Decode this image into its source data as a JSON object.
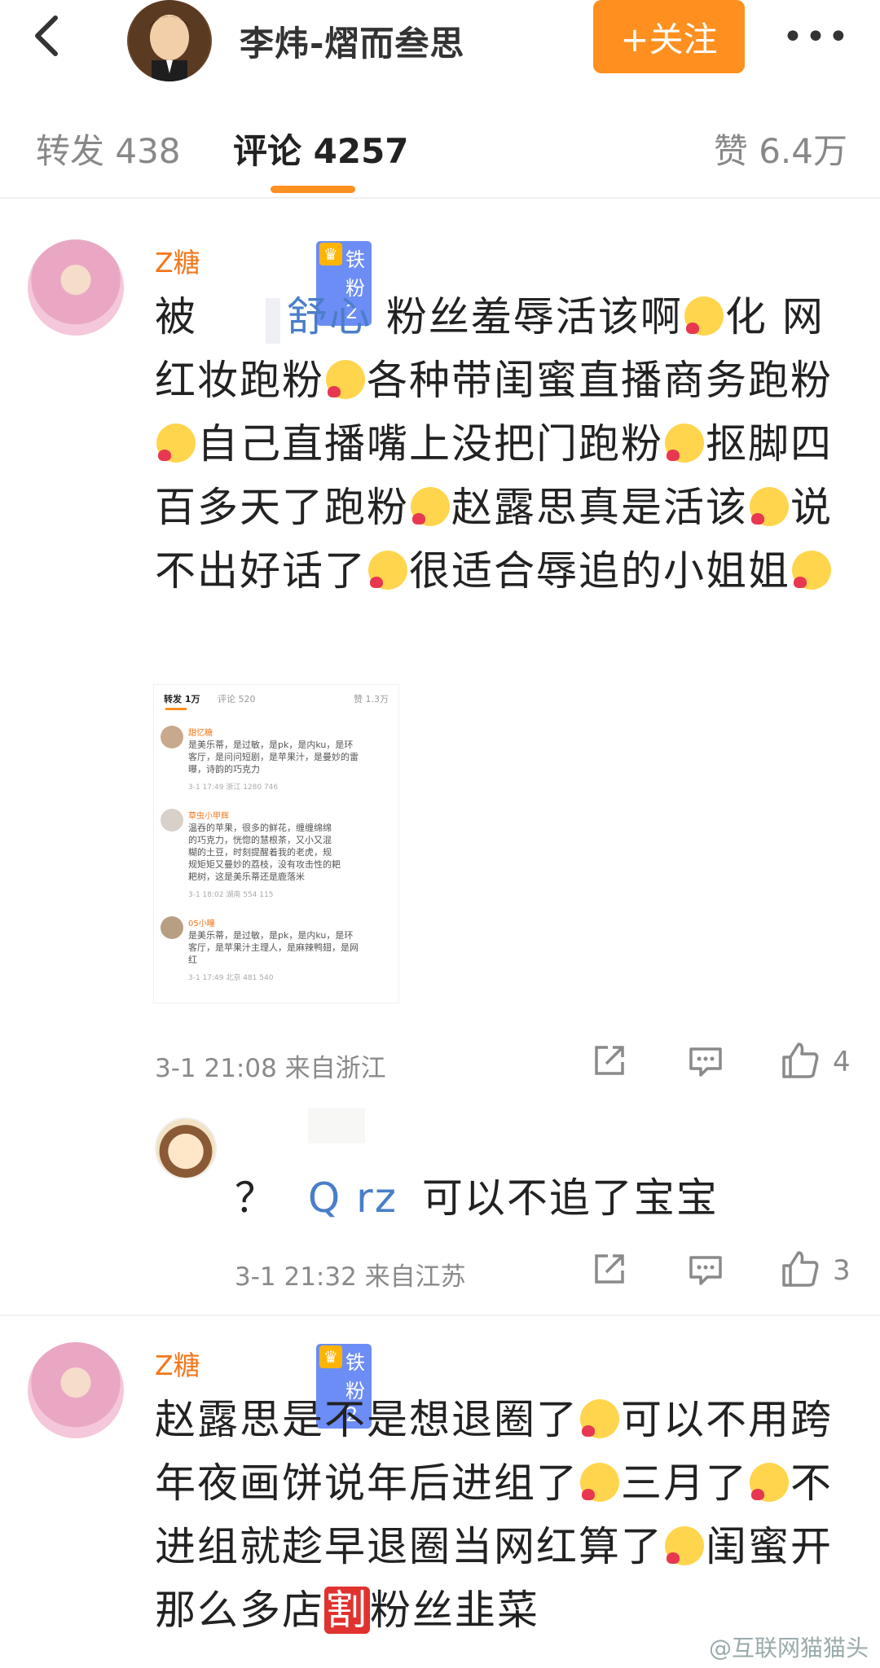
{
  "header": {
    "author_name": "李炜-熠而叁思",
    "follow_label": "+关注",
    "more_label": "•••"
  },
  "tabs": {
    "repost": "转发 438",
    "comment": "评论 4257",
    "like": "赞 6.4万"
  },
  "comments": [
    {
      "username": "Z糖",
      "badge": "铁粉2",
      "text_parts": [
        "被",
        "舒心",
        "粉丝羞辱活该啊",
        "化网红妆跑粉",
        "各种带闺蜜直播商务跑粉",
        "自己直播嘴上没把门跑粉",
        "抠脚四百多天了跑粉",
        "赵露思真是活该",
        "说不出好话了",
        "很适合辱追的小姐姐"
      ],
      "time_location": "3-1 21:08 来自浙江",
      "like_count": "4"
    },
    {
      "username": "",
      "text_prefix": "？",
      "text_mention": "Q rz",
      "text_main": "可以不追了宝宝",
      "time_location": "3-1 21:32 来自江苏",
      "like_count": "3"
    },
    {
      "username": "Z糖",
      "badge": "铁粉2",
      "text_parts": [
        "赵露思是不是想退圈了",
        "可以不用跨年夜画饼说年后进组了",
        "三月了",
        "不进组就趁早退圈当网红算了",
        "闺蜜开那么多店",
        "割",
        "粉丝韭菜"
      ]
    }
  ],
  "embed": {
    "tabs": {
      "repost": "转发 1万",
      "comment": "评论 520",
      "like": "赞 1.3万"
    },
    "items": [
      {
        "user": "甜忆糖",
        "lines": [
          "是美乐蒂，是过敏，是pk，是内ku，是环",
          "客厅，是问问短剧，是苹果汁，是曼妙的雷",
          "曝，诗韵的巧克力"
        ],
        "meta": "3-1 17:49  浙江 1280           746"
      },
      {
        "user": "草虫小甲辉",
        "lines": [
          "温吞的苹果，很多的鲜花，缠缠绵绵",
          "的巧克力，恍惚的慧根茶，又小又混",
          "糊的土豆，时刻提醒着我的老虎，规",
          "规矩矩又曼妙的荔枝，没有攻击性的耙",
          "耙树，这是美乐蒂还是鹿落米"
        ],
        "meta": "3-1 18:02  湖南 554            115"
      },
      {
        "user": "05小瞳",
        "lines": [
          "是美乐蒂，是过敏，是pk，是内ku，是环",
          "客厅，是苹果汁主理人，是麻辣鸭翅，是网",
          "红"
        ],
        "meta": "3-1 17:49  北京 481            540"
      }
    ]
  },
  "watermark": "@互联网猫猫头"
}
